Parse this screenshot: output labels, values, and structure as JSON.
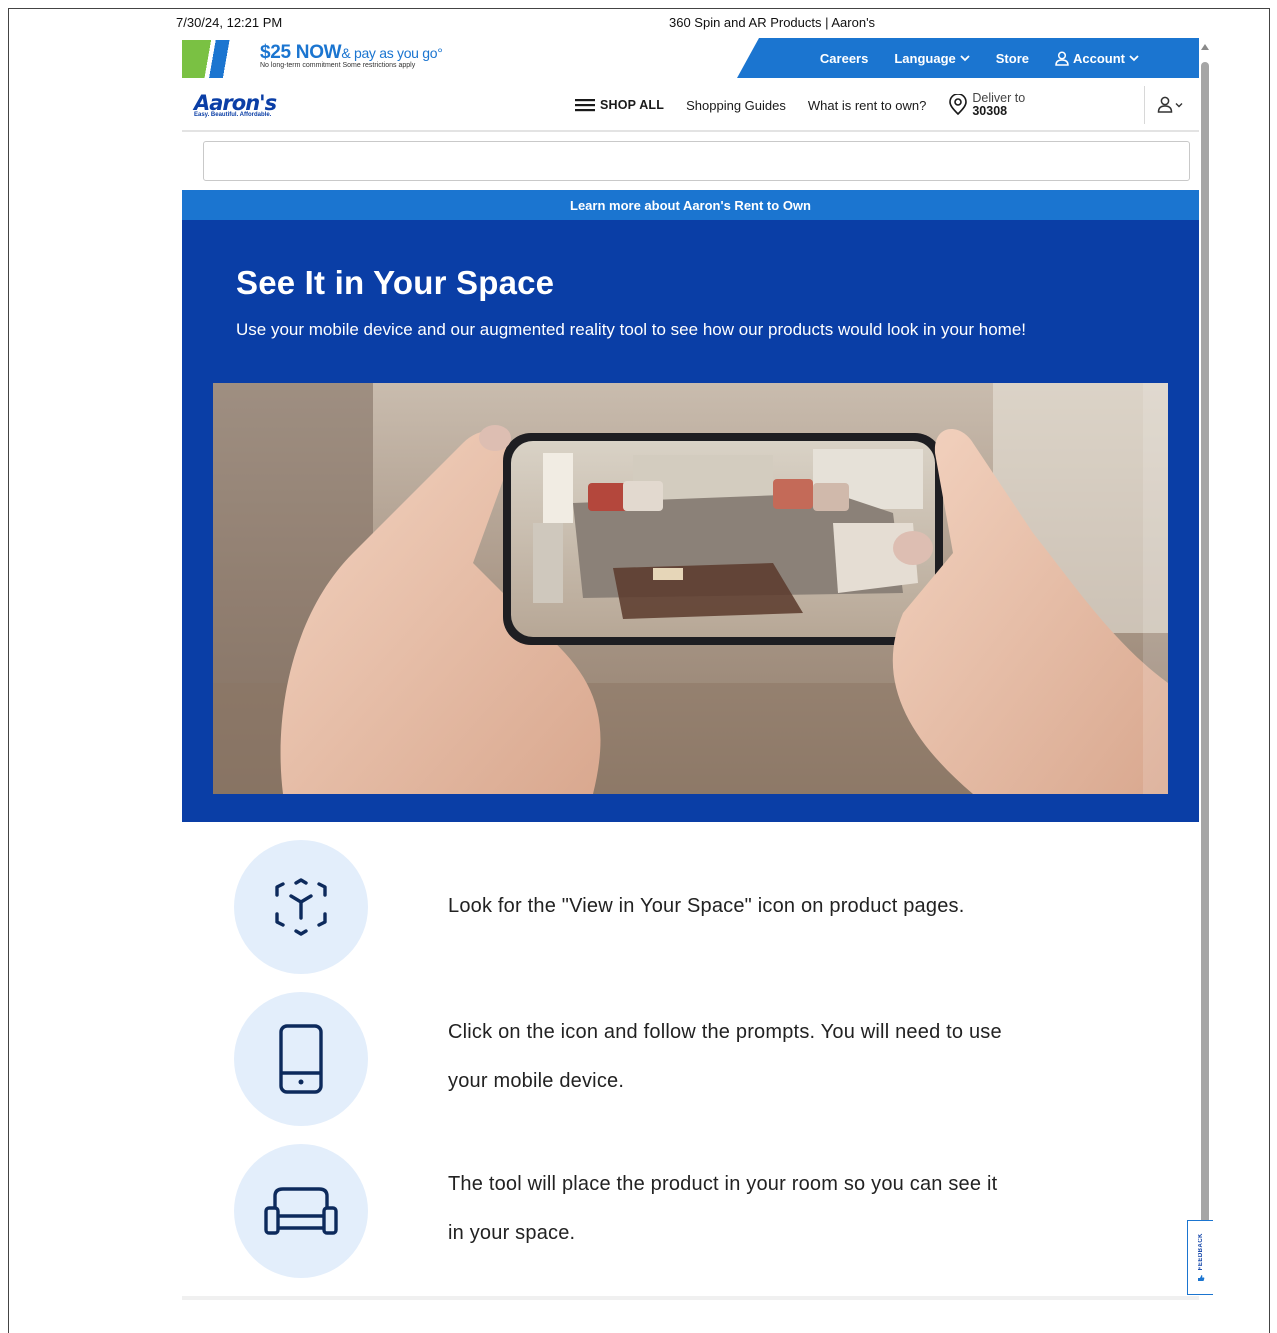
{
  "print_header": {
    "date": "7/30/24, 12:21 PM",
    "page_title": "360 Spin and AR Products | Aaron's"
  },
  "promo": {
    "amount": "$25 NOW",
    "rest": "& pay as you go°",
    "subtext": "No long-term commitment   Some restrictions apply"
  },
  "utility_nav": {
    "careers": "Careers",
    "language": "Language",
    "store": "Store",
    "account": "Account"
  },
  "logo": {
    "word": "Aaron's",
    "tagline": "Easy. Beautiful. Affordable."
  },
  "main_nav": {
    "shop_all": "SHOP ALL",
    "shopping_guides": "Shopping Guides",
    "rent_to_own": "What is rent to own?",
    "deliver_label": "Deliver to",
    "deliver_zip": "30308"
  },
  "search": {
    "value": "",
    "placeholder": ""
  },
  "learn_more": "Learn more about Aaron's Rent to Own",
  "hero": {
    "title": "See It in Your Space",
    "subtitle": "Use your mobile device and our augmented reality tool to see how our products would look in your home!"
  },
  "steps": [
    {
      "line1": "Look for the \"View in Your Space\" icon on product pages.",
      "line2": ""
    },
    {
      "line1": "Click on the icon and follow the prompts. You will need to use",
      "line2": "your mobile device."
    },
    {
      "line1": "The tool will place the product in your room so you can see it",
      "line2": "in your space."
    }
  ],
  "feedback": "FEEDBACK",
  "icons": {
    "menu": "hamburger-icon",
    "location": "location-pin-icon",
    "user": "user-icon",
    "ar": "ar-cube-icon",
    "phone": "phone-icon",
    "sofa": "sofa-icon"
  },
  "colors": {
    "hero_blue": "#0a3ea6",
    "accent_blue": "#1b75d0",
    "step_circle": "#e3eefb",
    "promo_green": "#7ac143"
  }
}
